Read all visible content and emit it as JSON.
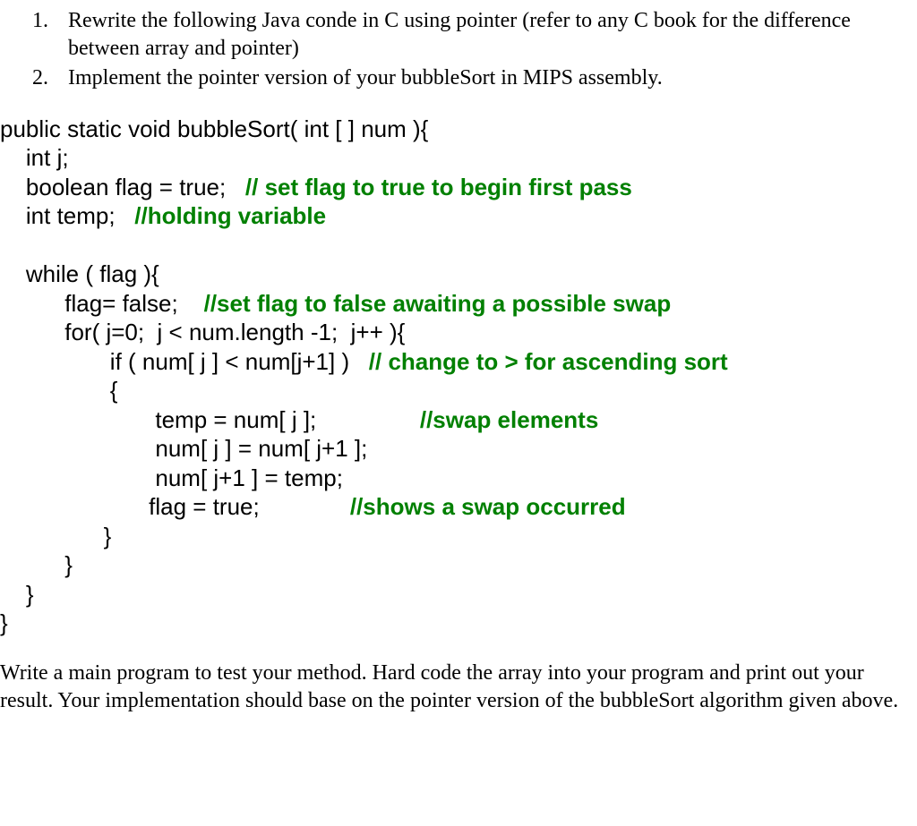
{
  "questions": {
    "q1_number": "1.",
    "q1_text": "Rewrite the following Java conde in C using pointer (refer to any C book for the difference between array and pointer)",
    "q2_number": "2.",
    "q2_text": "Implement the pointer version of your bubbleSort in MIPS assembly."
  },
  "code": {
    "line1": "public static void bubbleSort( int [ ] num ){",
    "line2": "    int j;",
    "line3a": "    boolean flag = true;   ",
    "line3b": "// set flag to true to begin first pass",
    "line4a": "    int temp;   ",
    "line4b": "//holding variable",
    "line5": "",
    "line6": "    while ( flag ){",
    "line7a": "          flag= false;    ",
    "line7b": "//set flag to false awaiting a possible swap",
    "line8": "          for( j=0;  j < num.length -1;  j++ ){",
    "line9a": "                 if ( num[ j ] < num[j+1] )   ",
    "line9b": "// change to > for ascending sort",
    "line10": "                 {",
    "line11a": "                        temp = num[ j ];                ",
    "line11b": "//swap elements",
    "line12": "                        num[ j ] = num[ j+1 ];",
    "line13": "                        num[ j+1 ] = temp;",
    "line14a": "                       flag = true;              ",
    "line14b": "//shows a swap occurred",
    "line15": "                }",
    "line16": "          }",
    "line17": "    }",
    "line18": "}"
  },
  "footer": {
    "text": "Write a main program to test your method.  Hard code the array into your program and print out your result. Your implementation should base on the pointer version of the bubbleSort algorithm given above."
  }
}
